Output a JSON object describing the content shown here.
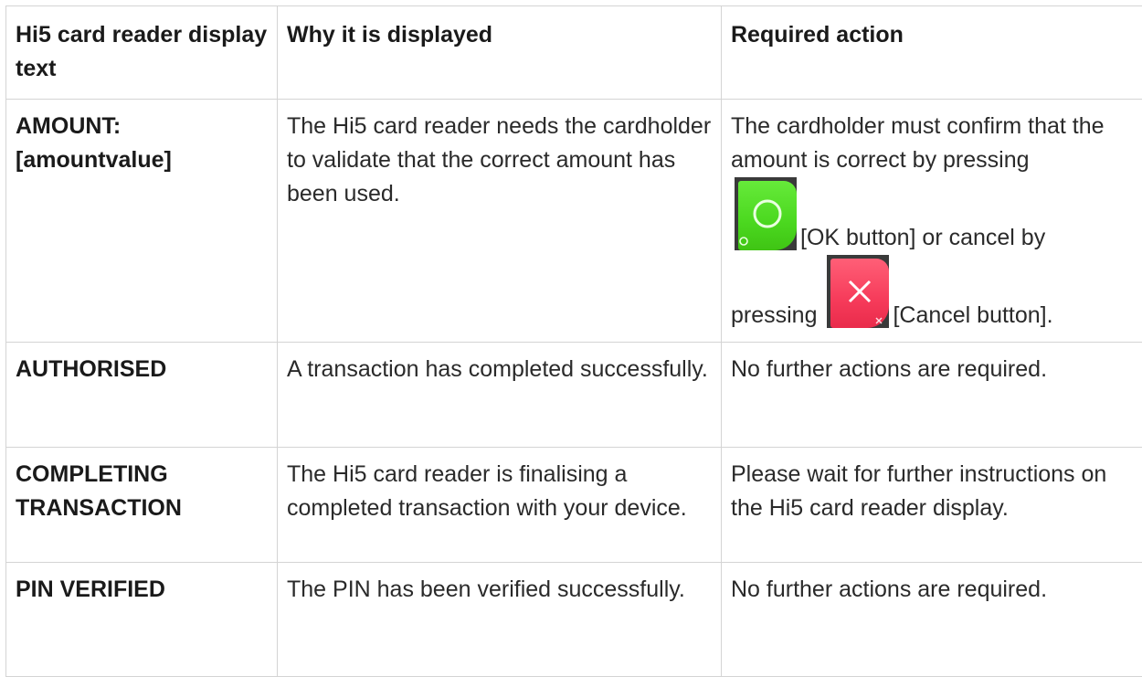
{
  "headers": {
    "col1": "Hi5 card reader display text",
    "col2": "Why it is displayed",
    "col3": "Required action"
  },
  "rows": [
    {
      "display_text": "AMOUNT: [amountvalue]",
      "reason": "The Hi5 card reader needs the cardholder to validate that the correct amount has been used.",
      "action_part1": "The cardholder must confirm that the amount is correct by pressing",
      "ok_button_icon": "green-ok-key-icon",
      "action_part2": "[OK button] or cancel by",
      "action_part3": "pressing",
      "cancel_button_icon": "red-cancel-key-icon",
      "action_part4": "[Cancel button]."
    },
    {
      "display_text": "AUTHORISED",
      "reason": "A transaction has completed successfully.",
      "action": "No further actions are required."
    },
    {
      "display_text": "COMPLETING TRANSACTION",
      "reason": "The Hi5 card reader is finalising a completed transaction with your device.",
      "action": "Please wait for further instructions on the Hi5 card reader display."
    },
    {
      "display_text": "PIN VERIFIED",
      "reason": "The PIN has been verified successfully.",
      "action": "No further actions are required."
    }
  ],
  "colors": {
    "border": "#d4d4d4",
    "ok_key": "#4bd81f",
    "cancel_key": "#f63b5a"
  }
}
